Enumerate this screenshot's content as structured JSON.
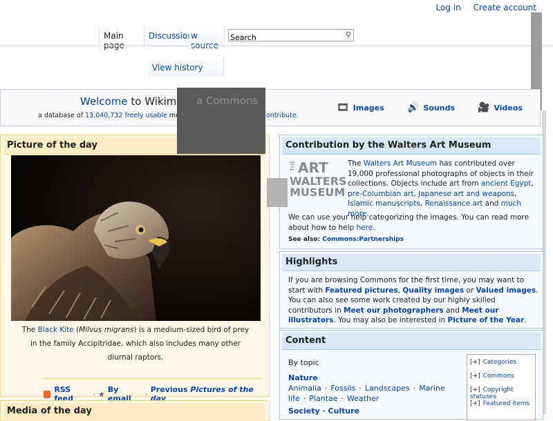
{
  "personal": {
    "login": "Log in",
    "create_account": "Create account"
  },
  "tabs": {
    "main_page": "Main page",
    "discussion": "Discussion",
    "view_source": "w source",
    "view_history": "View history"
  },
  "search": {
    "placeholder": "Search",
    "value": "Search"
  },
  "welcome": {
    "welcome_word": "Welcome",
    "title_rest": " to Wikime",
    "title_tail": "a Commons",
    "sub_prefix": "a database of ",
    "file_count": "13,040,732",
    "freely_usable": "freely usable",
    "sub_suffix": " medi",
    "contribute": "ontribute.",
    "media_links": [
      {
        "label": "Images",
        "icon": "film-strip-icon"
      },
      {
        "label": "Sounds",
        "icon": "speaker-icon"
      },
      {
        "label": "Videos",
        "icon": "film-reel-icon"
      }
    ]
  },
  "potd": {
    "heading": "Picture of the day",
    "caption_pre": "The ",
    "caption_link": "Black Kite",
    "caption_open": " (",
    "caption_species": "Milvus migrans",
    "caption_rest": ") is a medium-sized bird of prey in the family Accipitridae, which also includes many other diurnal raptors.",
    "rss": "RSS feed",
    "email": "By email",
    "previous_prefix": "Previous ",
    "previous_em": "Pictures of the day"
  },
  "motd": {
    "heading": "Media of the day"
  },
  "walters": {
    "heading": "Contribution by the Walters Art Museum",
    "logo_lines": [
      "THE",
      "ART",
      "WALTERS",
      "MUSEUM"
    ],
    "p1_the": "The ",
    "p1_link": "Walters Art Museum",
    "p1_rest": " has contributed over 19,000 professional photographs of objects in their collections. Objects include art from ",
    "link_egypt": "ancient Egypt",
    "link_precol": "pre-Columbian art",
    "link_japanese": "Japanese art and weapons",
    "link_islamic": "Islamic manuscripts",
    "link_renaissance": "Renaissance art",
    "and": " and ",
    "link_more": "much more",
    "help_text": "We can use your help categorizing the images. You can read more about how to help ",
    "help_link": "here",
    "see_also_label": "See also: ",
    "see_also_link": "Commons:Partnerships"
  },
  "highlights": {
    "heading": "Highlights",
    "t1": "If you are browsing Commons for the first time, you may want to start with ",
    "featured": "Featured pictures",
    "quality": "Quality images",
    "t_or": " or ",
    "valued": "Valued images",
    "t2": ". You can also see some work created by our highly skilled contributors in ",
    "photographers": "Meet our photographers",
    "t_and": " and ",
    "illustrators": "Meet our illustrators",
    "t3": ". You may also be interested in ",
    "poty": "Picture of the Year",
    "t4": "."
  },
  "content": {
    "heading": "Content",
    "by_topic": "By topic",
    "nature": "Nature",
    "nature_items": [
      "Animalia",
      "Fossils",
      "Landscapes",
      "Marine life",
      "Plantae",
      "Weather"
    ],
    "society": "Society · Culture",
    "categories": [
      {
        "toggle": "[+]",
        "label": "Categories"
      },
      {
        "toggle": "[+]",
        "label": "Commons"
      },
      {
        "toggle": "[+]",
        "label": "Copyright statuses"
      },
      {
        "toggle": "[+]",
        "label": "Featured items"
      }
    ]
  }
}
